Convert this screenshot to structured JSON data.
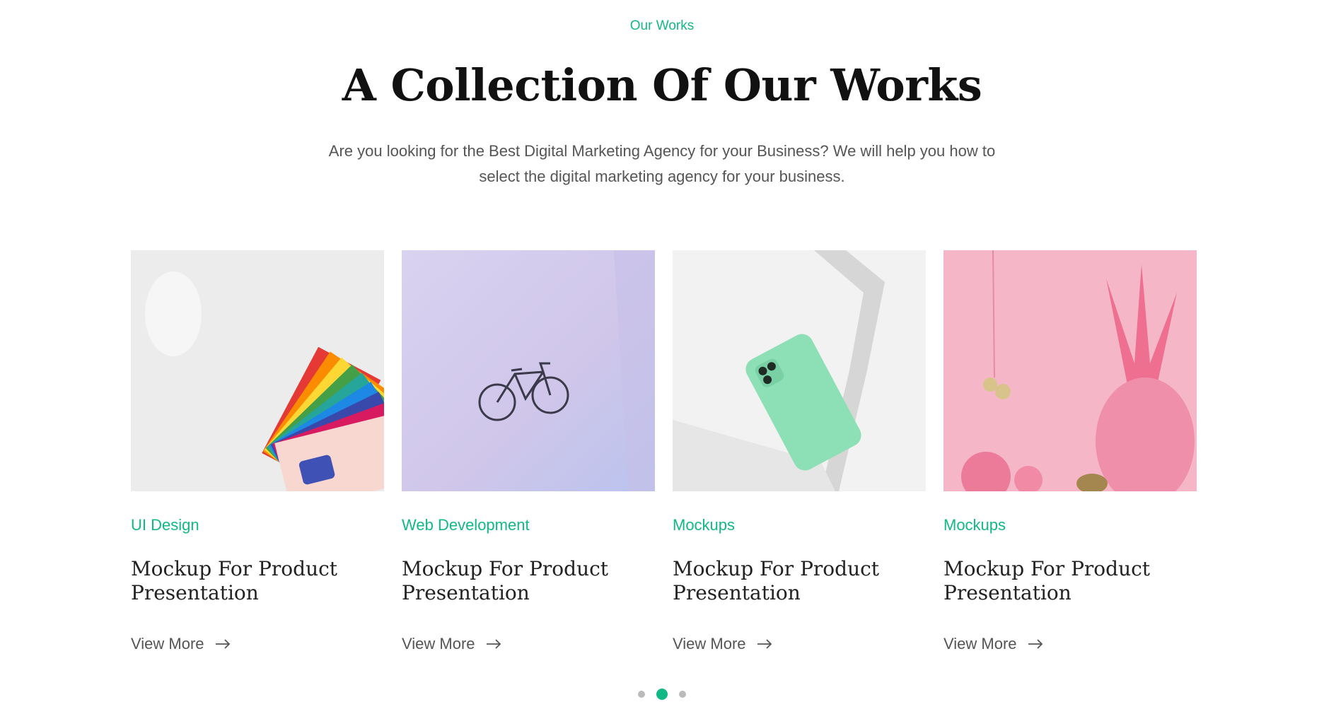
{
  "header": {
    "eyebrow": "Our Works",
    "title": "A Collection Of Our Works",
    "subtitle": "Are you looking for the Best Digital Marketing Agency for your Business? We will help you how to select the digital marketing agency for your business."
  },
  "cards": [
    {
      "category": "UI Design",
      "title": "Mockup For Product Presentation",
      "link_label": "View More",
      "image": "color-swatch-cards-image"
    },
    {
      "category": "Web Development",
      "title": "Mockup For Product Presentation",
      "link_label": "View More",
      "image": "bicycle-on-lilac-wall-image"
    },
    {
      "category": "Mockups",
      "title": "Mockup For Product Presentation",
      "link_label": "View More",
      "image": "green-phone-mockup-image"
    },
    {
      "category": "Mockups",
      "title": "Mockup For Product Presentation",
      "link_label": "View More",
      "image": "pink-pineapple-image"
    }
  ],
  "pagination": {
    "count": 3,
    "active_index": 1
  },
  "colors": {
    "accent": "#12b886",
    "heading": "#111111",
    "body_text": "#555555",
    "dot_inactive": "#bbbbbb"
  },
  "icons": {
    "link_arrow": "arrow-right-icon"
  }
}
